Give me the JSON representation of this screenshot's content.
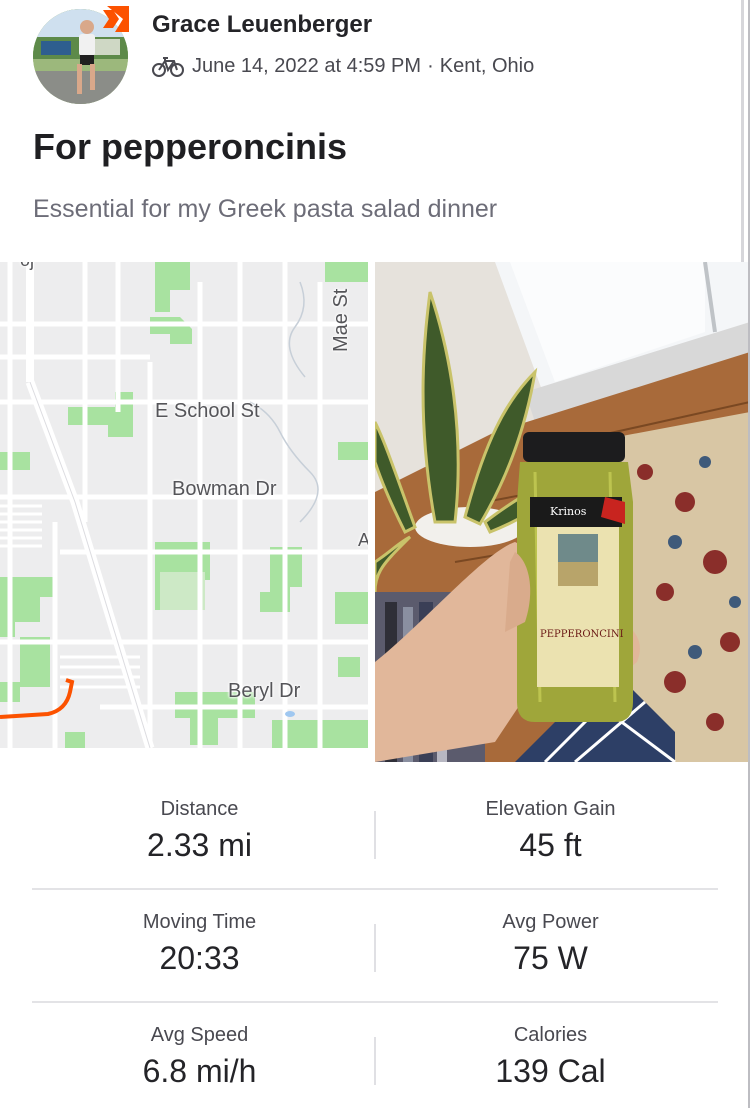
{
  "activity": {
    "athlete_name": "Grace Leuenberger",
    "activity_type_icon": "bike-icon",
    "datetime": "June 14, 2022 at 4:59 PM",
    "separator": "·",
    "location": "Kent, Ohio",
    "title": "For pepperoncinis",
    "description": "Essential for my Greek pasta salad dinner"
  },
  "map": {
    "streets": {
      "school": "E School St",
      "bowman": "Bowman Dr",
      "beryl": "Beryl Dr",
      "mae": "Mae St",
      "partial_top": "oj",
      "partial_right": "A"
    },
    "route_color": "#fc5200",
    "park_color": "#a8e2a0"
  },
  "photo": {
    "jar_brand": "Krinos",
    "jar_label": "PEPPERONCINI"
  },
  "stats": [
    {
      "label": "Distance",
      "value": "2.33 mi"
    },
    {
      "label": "Elevation Gain",
      "value": "45 ft"
    },
    {
      "label": "Moving Time",
      "value": "20:33"
    },
    {
      "label": "Avg Power",
      "value": "75 W"
    },
    {
      "label": "Avg Speed",
      "value": "6.8 mi/h"
    },
    {
      "label": "Calories",
      "value": "139 Cal"
    }
  ],
  "colors": {
    "brand": "#fc5200",
    "text_primary": "#242428",
    "text_secondary": "#6d6d78"
  }
}
